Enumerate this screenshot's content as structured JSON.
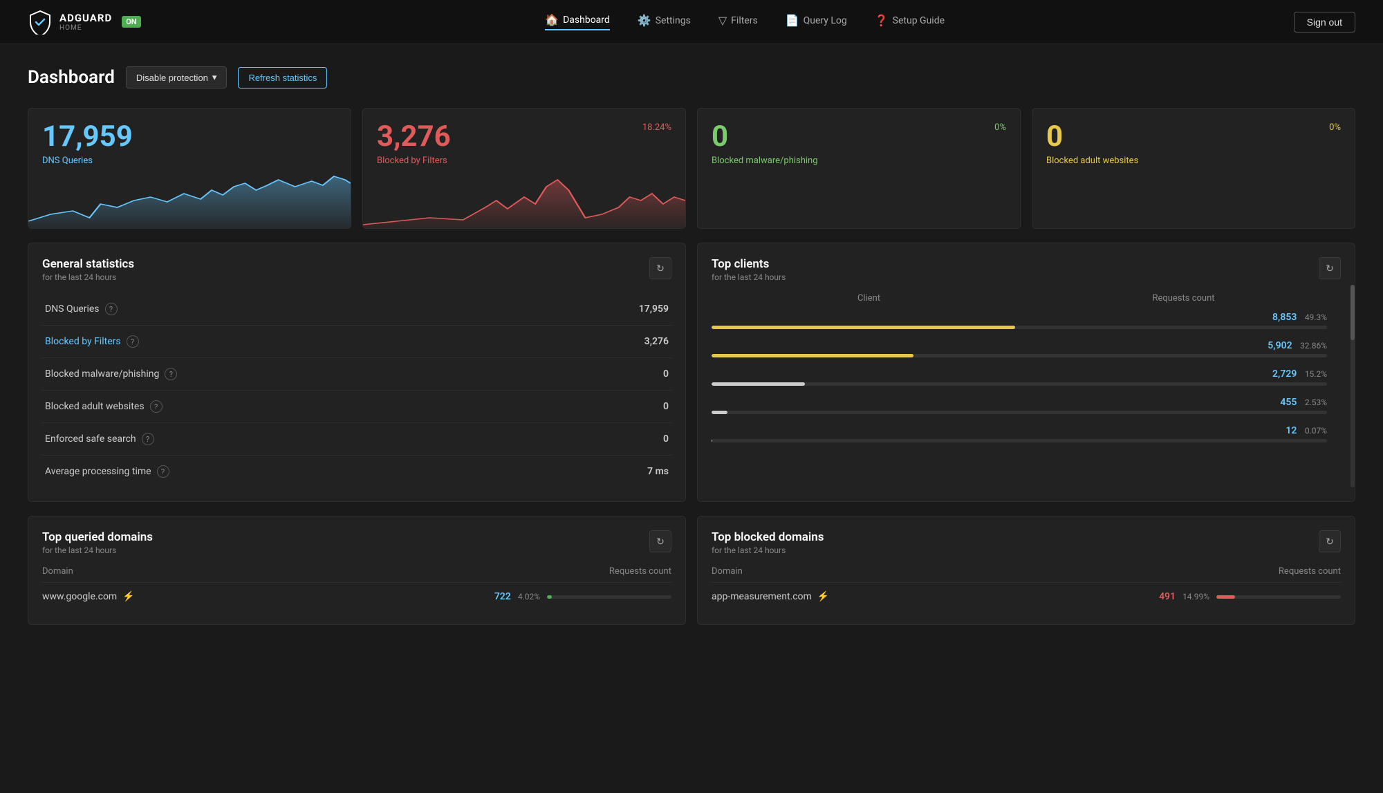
{
  "nav": {
    "brand": "ADGUARD",
    "brand_sub": "HOME",
    "status": "ON",
    "links": [
      {
        "label": "Dashboard",
        "icon": "🏠",
        "active": true
      },
      {
        "label": "Settings",
        "icon": "⚙️",
        "active": false
      },
      {
        "label": "Filters",
        "icon": "▽",
        "active": false
      },
      {
        "label": "Query Log",
        "icon": "📄",
        "active": false
      },
      {
        "label": "Setup Guide",
        "icon": "❓",
        "active": false
      }
    ],
    "sign_out": "Sign out"
  },
  "dashboard": {
    "title": "Dashboard",
    "disable_btn": "Disable protection",
    "refresh_btn": "Refresh statistics"
  },
  "stat_cards": [
    {
      "number": "17,959",
      "color": "blue",
      "label": "DNS Queries",
      "percent": null,
      "has_chart": true
    },
    {
      "number": "3,276",
      "color": "red",
      "label": "Blocked by Filters",
      "percent": "18.24%",
      "percent_color": "red",
      "has_chart": true
    },
    {
      "number": "0",
      "color": "green",
      "label": "Blocked malware/phishing",
      "percent": "0%",
      "percent_color": "green",
      "has_chart": false
    },
    {
      "number": "0",
      "color": "yellow",
      "label": "Blocked adult websites",
      "percent": "0%",
      "percent_color": "yellow",
      "has_chart": false
    }
  ],
  "general_stats": {
    "title": "General statistics",
    "subtitle": "for the last 24 hours",
    "rows": [
      {
        "label": "DNS Queries",
        "help": true,
        "link": false,
        "value": "17,959",
        "value_color": "blue"
      },
      {
        "label": "Blocked by Filters",
        "help": true,
        "link": true,
        "value": "3,276",
        "value_color": "blue"
      },
      {
        "label": "Blocked malware/phishing",
        "help": true,
        "link": false,
        "value": "0",
        "value_color": "blue"
      },
      {
        "label": "Blocked adult websites",
        "help": true,
        "link": false,
        "value": "0",
        "value_color": "blue"
      },
      {
        "label": "Enforced safe search",
        "help": true,
        "link": false,
        "value": "0",
        "value_color": "blue"
      },
      {
        "label": "Average processing time",
        "help": true,
        "link": false,
        "value": "7 ms",
        "value_color": "white"
      }
    ]
  },
  "top_clients": {
    "title": "Top clients",
    "subtitle": "for the last 24 hours",
    "col_client": "Client",
    "col_requests": "Requests count",
    "rows": [
      {
        "count": "8,853",
        "pct": "49.3%",
        "bar_pct": 49.3
      },
      {
        "count": "5,902",
        "pct": "32.86%",
        "bar_pct": 32.86
      },
      {
        "count": "2,729",
        "pct": "15.2%",
        "bar_pct": 15.2
      },
      {
        "count": "455",
        "pct": "2.53%",
        "bar_pct": 2.53
      },
      {
        "count": "12",
        "pct": "0.07%",
        "bar_pct": 0.07
      }
    ]
  },
  "top_queried": {
    "title": "Top queried domains",
    "subtitle": "for the last 24 hours",
    "col_domain": "Domain",
    "col_requests": "Requests count",
    "rows": [
      {
        "domain": "www.google.com",
        "count": "722",
        "pct": "4.02%",
        "bar_pct": 4.02,
        "type": "green"
      }
    ]
  },
  "top_blocked": {
    "title": "Top blocked domains",
    "subtitle": "for the last 24 hours",
    "col_domain": "Domain",
    "col_requests": "Requests count",
    "rows": [
      {
        "domain": "app-measurement.com",
        "count": "491",
        "pct": "14.99%",
        "bar_pct": 14.99,
        "type": "red"
      }
    ]
  }
}
